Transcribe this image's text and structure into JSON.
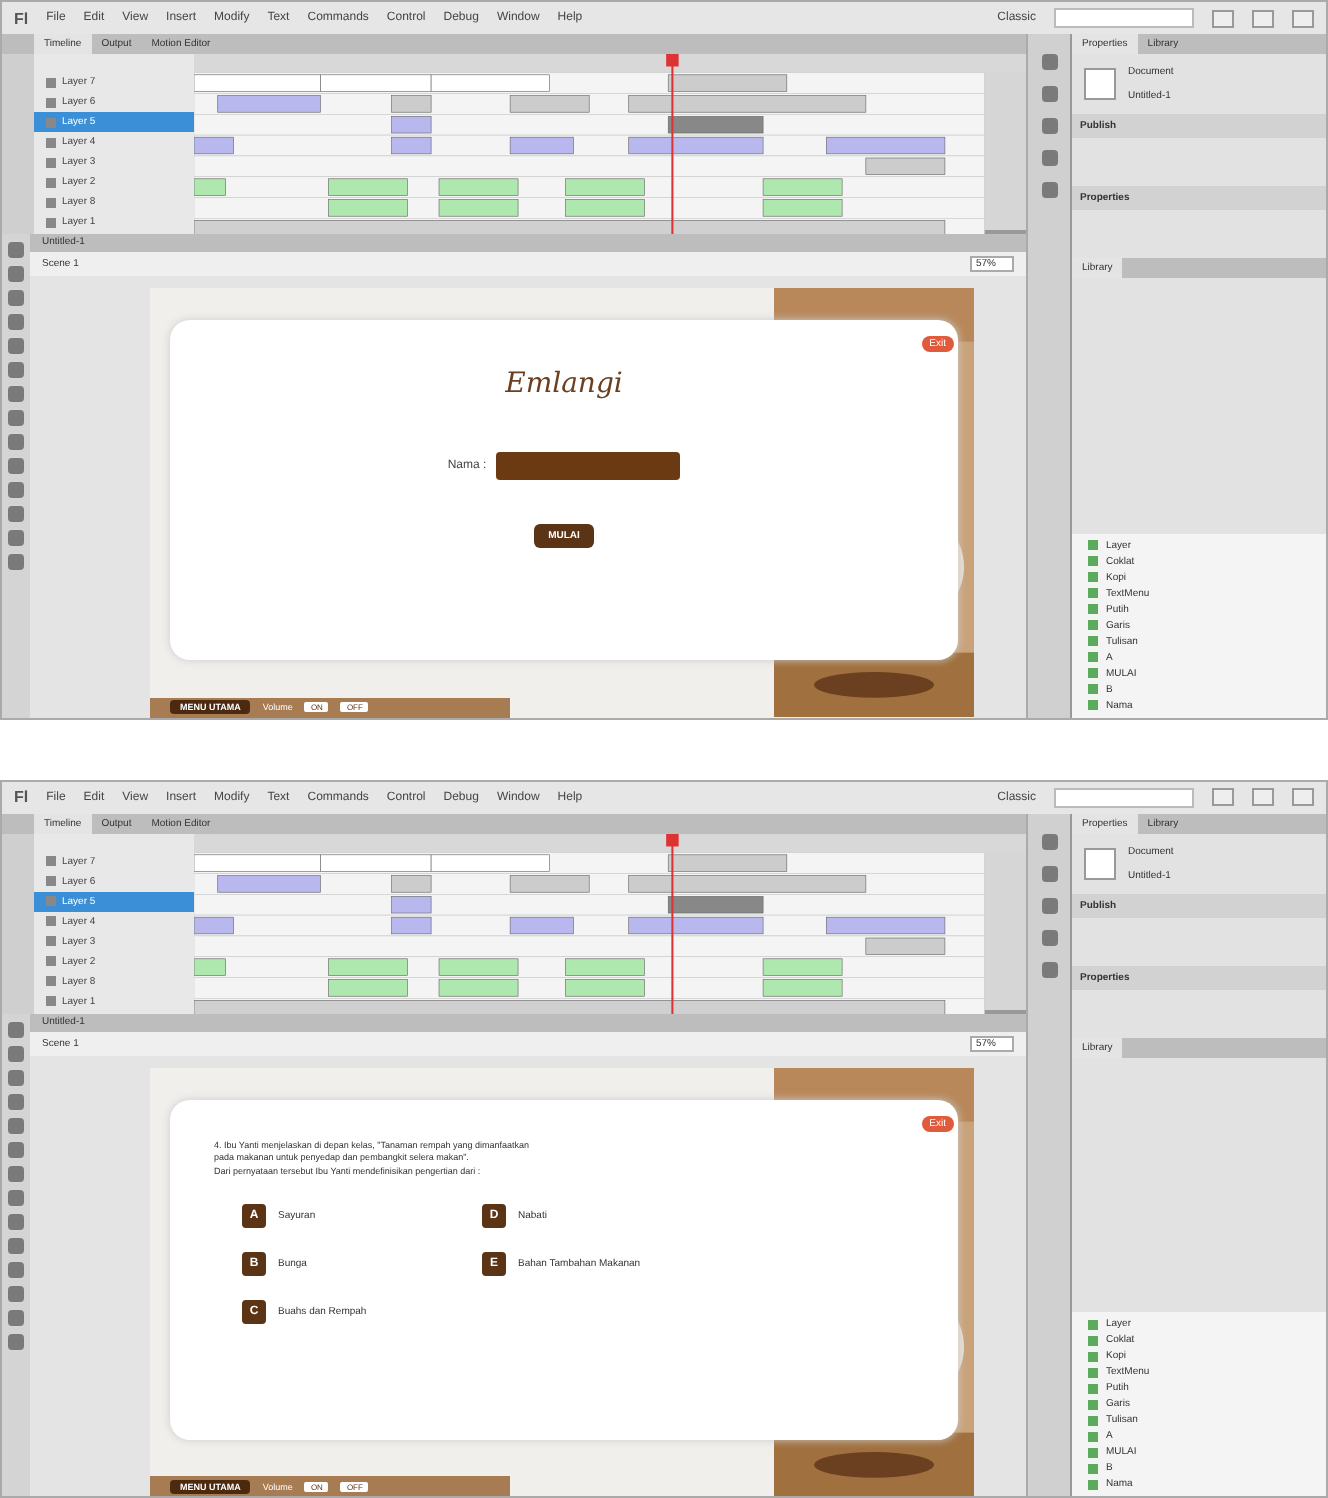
{
  "screens": [
    {
      "menu": [
        "Fl",
        "File",
        "Edit",
        "View",
        "Insert",
        "Modify",
        "Text",
        "Commands",
        "Control",
        "Debug",
        "Window",
        "Help"
      ],
      "workspace": "Classic",
      "timeline": {
        "tabs": [
          {
            "label": "Timeline",
            "selected": true
          },
          {
            "label": "Output",
            "selected": false
          },
          {
            "label": "Motion Editor",
            "selected": false
          }
        ],
        "layers": [
          {
            "name": "Layer 7",
            "selected": false
          },
          {
            "name": "Layer 6",
            "selected": false
          },
          {
            "name": "Layer 5",
            "selected": true
          },
          {
            "name": "Layer 4",
            "selected": false
          },
          {
            "name": "Layer 3",
            "selected": false
          },
          {
            "name": "Layer 2",
            "selected": false
          },
          {
            "name": "Layer 8",
            "selected": false
          },
          {
            "name": "Layer 1",
            "selected": false
          }
        ]
      },
      "stage": {
        "tab": "Untitled-1",
        "scene": "Scene 1",
        "zoom": "57%",
        "badge": "Exit",
        "menu_button": "MENU UTAMA",
        "footer_label": "Volume",
        "footer_buttons": [
          "ON",
          "OFF"
        ],
        "content": {
          "kind": "login",
          "title": "Emlangi",
          "field_label": "Nama :",
          "button": "MULAI"
        }
      },
      "panel": {
        "tabs": [
          {
            "label": "Properties",
            "selected": true
          },
          {
            "label": "Library",
            "selected": false
          }
        ],
        "doc_type": "Document",
        "doc_name": "Untitled-1",
        "sections": [
          "Publish",
          "Properties"
        ],
        "library_tabs": [
          {
            "label": "Library",
            "selected": true
          }
        ],
        "library_items": [
          "Layer",
          "Coklat",
          "Kopi",
          "TextMenu",
          "Putih",
          "Garis",
          "Tulisan",
          "A",
          "MULAI",
          "B",
          "Nama"
        ]
      }
    },
    {
      "menu": [
        "Fl",
        "File",
        "Edit",
        "View",
        "Insert",
        "Modify",
        "Text",
        "Commands",
        "Control",
        "Debug",
        "Window",
        "Help"
      ],
      "workspace": "Classic",
      "timeline": {
        "tabs": [
          {
            "label": "Timeline",
            "selected": true
          },
          {
            "label": "Output",
            "selected": false
          },
          {
            "label": "Motion Editor",
            "selected": false
          }
        ],
        "layers": [
          {
            "name": "Layer 7",
            "selected": false
          },
          {
            "name": "Layer 6",
            "selected": false
          },
          {
            "name": "Layer 5",
            "selected": true
          },
          {
            "name": "Layer 4",
            "selected": false
          },
          {
            "name": "Layer 3",
            "selected": false
          },
          {
            "name": "Layer 2",
            "selected": false
          },
          {
            "name": "Layer 8",
            "selected": false
          },
          {
            "name": "Layer 1",
            "selected": false
          }
        ]
      },
      "stage": {
        "tab": "Untitled-1",
        "scene": "Scene 1",
        "zoom": "57%",
        "badge": "Exit",
        "menu_button": "MENU UTAMA",
        "footer_label": "Volume",
        "footer_buttons": [
          "ON",
          "OFF"
        ],
        "content": {
          "kind": "quiz",
          "question": [
            "4. Ibu Yanti menjelaskan di depan kelas, \"Tanaman rempah yang dimanfaatkan",
            "pada makanan untuk penyedap dan pembangkit selera makan\".",
            "Dari pernyataan tersebut Ibu Yanti mendefinisikan pengertian dari :"
          ],
          "options": [
            {
              "letter": "A",
              "text": "Sayuran"
            },
            {
              "letter": "D",
              "text": "Nabati"
            },
            {
              "letter": "B",
              "text": "Bunga"
            },
            {
              "letter": "E",
              "text": "Bahan Tambahan Makanan"
            },
            {
              "letter": "C",
              "text": "Buahs dan Rempah"
            }
          ]
        }
      },
      "panel": {
        "tabs": [
          {
            "label": "Properties",
            "selected": true
          },
          {
            "label": "Library",
            "selected": false
          }
        ],
        "doc_type": "Document",
        "doc_name": "Untitled-1",
        "sections": [
          "Publish",
          "Properties"
        ],
        "library_tabs": [
          {
            "label": "Library",
            "selected": true
          }
        ],
        "library_items": [
          "Layer",
          "Coklat",
          "Kopi",
          "TextMenu",
          "Putih",
          "Garis",
          "Tulisan",
          "A",
          "MULAI",
          "B",
          "Nama"
        ]
      }
    }
  ]
}
